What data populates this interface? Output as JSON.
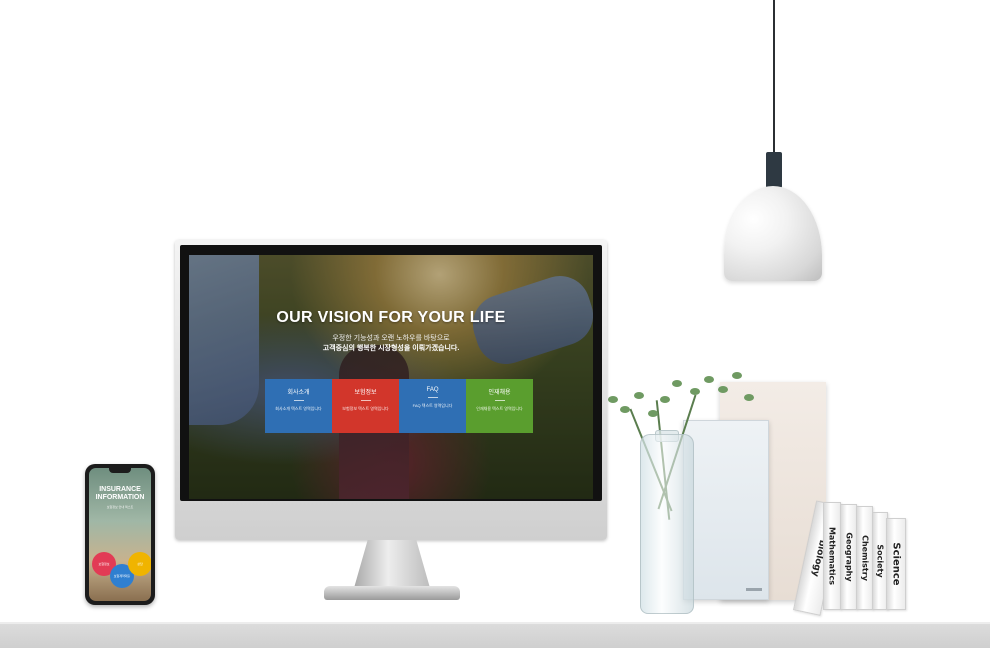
{
  "monitor_site": {
    "hero_title": "OUR VISION FOR YOUR LIFE",
    "hero_subtitle_1": "우정한 기능성과 오랜 노하우를 바탕으로",
    "hero_subtitle_2": "고객중심의 행복한 시장형성을 이뤄가겠습니다.",
    "tiles": [
      {
        "title": "회사소개",
        "desc": "회사소개 텍스트 영역입니다",
        "color": "#2f6fb4"
      },
      {
        "title": "보험정보",
        "desc": "보험정보 텍스트 영역입니다",
        "color": "#d2362b"
      },
      {
        "title": "FAQ",
        "desc": "FAQ 텍스트 영역입니다",
        "color": "#2f6fb4"
      },
      {
        "title": "인재채용",
        "desc": "인재채용 텍스트 영역입니다",
        "color": "#5a9e2e"
      }
    ]
  },
  "phone_site": {
    "title_line1": "INSURANCE",
    "title_line2": "INFORMATION",
    "subtitle": "보험정보 안내 텍스트",
    "circles": [
      {
        "label": "보험정보",
        "color": "#e23b55"
      },
      {
        "label": "보험계약대출",
        "color": "#2f7fd0"
      },
      {
        "label": "상담",
        "color": "#f0b400"
      }
    ]
  },
  "books": [
    "biology",
    "Mathematics",
    "Geography",
    "Chemistry",
    "Society",
    "Science"
  ]
}
